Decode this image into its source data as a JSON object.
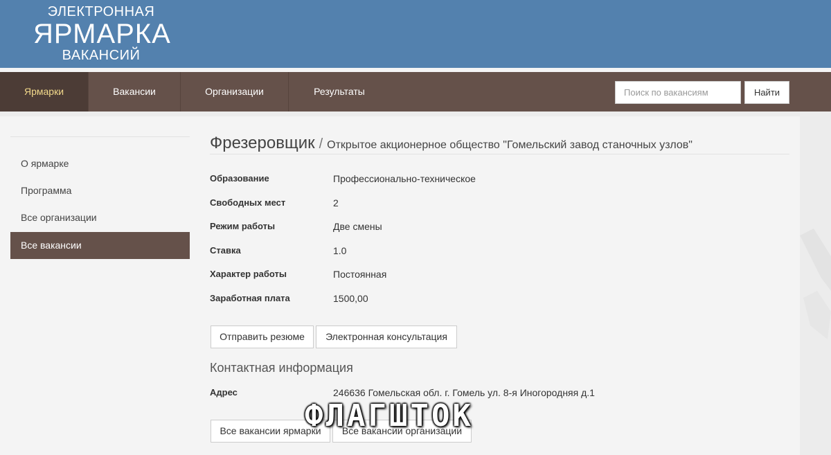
{
  "logo": {
    "line1": "ЭЛЕКТРОННАЯ",
    "line2": "ЯРМАРКА",
    "line3": "ВАКАНСИЙ"
  },
  "nav": {
    "items": [
      {
        "label": "Ярмарки",
        "active": true
      },
      {
        "label": "Вакансии",
        "active": false
      },
      {
        "label": "Организации",
        "active": false
      },
      {
        "label": "Результаты",
        "active": false
      }
    ],
    "search_placeholder": "Поиск по вакансиям",
    "search_button": "Найти"
  },
  "sidebar": {
    "items": [
      {
        "label": "О ярмарке",
        "active": false
      },
      {
        "label": "Программа",
        "active": false
      },
      {
        "label": "Все организации",
        "active": false
      },
      {
        "label": "Все вакансии",
        "active": true
      }
    ]
  },
  "vacancy": {
    "title": "Фрезеровщик",
    "separator": "/",
    "organization": "Открытое акционерное общество \"Гомельский завод станочных узлов\"",
    "fields": [
      {
        "label": "Образование",
        "value": "Профессионально-техническое"
      },
      {
        "label": "Свободных мест",
        "value": "2"
      },
      {
        "label": "Режим работы",
        "value": "Две смены"
      },
      {
        "label": "Ставка",
        "value": "1.0"
      },
      {
        "label": "Характер работы",
        "value": "Постоянная"
      },
      {
        "label": "Заработная плата",
        "value": "1500,00"
      }
    ],
    "buttons": {
      "send_resume": "Отправить резюме",
      "consultation": "Электронная консультация"
    }
  },
  "contacts": {
    "title": "Контактная информация",
    "address_label": "Адрес",
    "address_value": "246636 Гомельская обл. г. Гомель ул. 8-я Иногородняя д.1"
  },
  "bottom_buttons": {
    "fair_vacancies": "Все вакансии ярмарки",
    "org_vacancies": "Все вакансии организации"
  },
  "watermark": "ФЛАГШТОК",
  "colors": {
    "header_blue": "#5381ae",
    "nav_brown": "#65514a",
    "nav_active": "#4c3c36",
    "nav_active_text": "#f2d98b"
  }
}
